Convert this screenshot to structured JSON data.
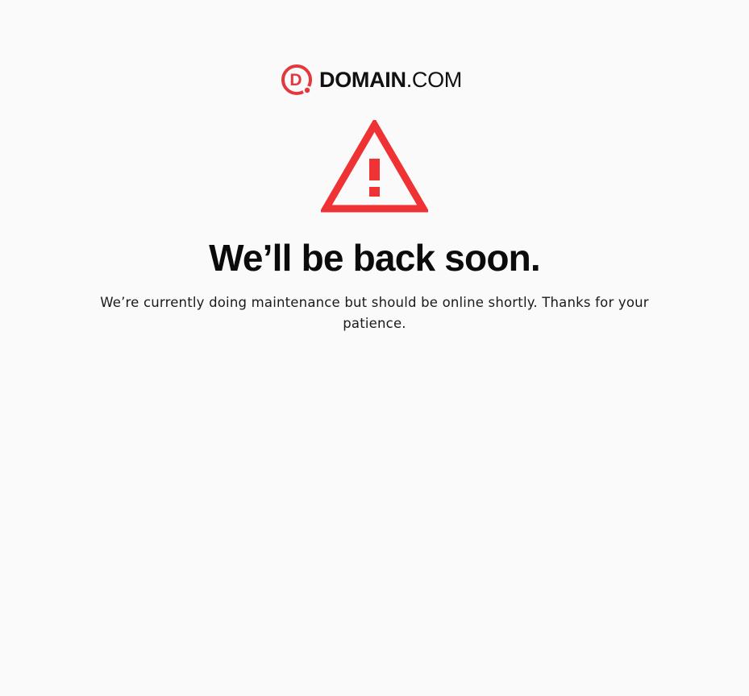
{
  "brand": {
    "logo_letter": "D",
    "name_bold": "DOMAIN",
    "name_light": ".COM",
    "accent_color": "#e3383d"
  },
  "alert": {
    "icon": "warning-triangle-icon",
    "color": "#ef3234"
  },
  "maintenance": {
    "headline": "We’ll be back soon.",
    "message": "We’re currently doing maintenance but should be online shortly. Thanks for your patience."
  }
}
